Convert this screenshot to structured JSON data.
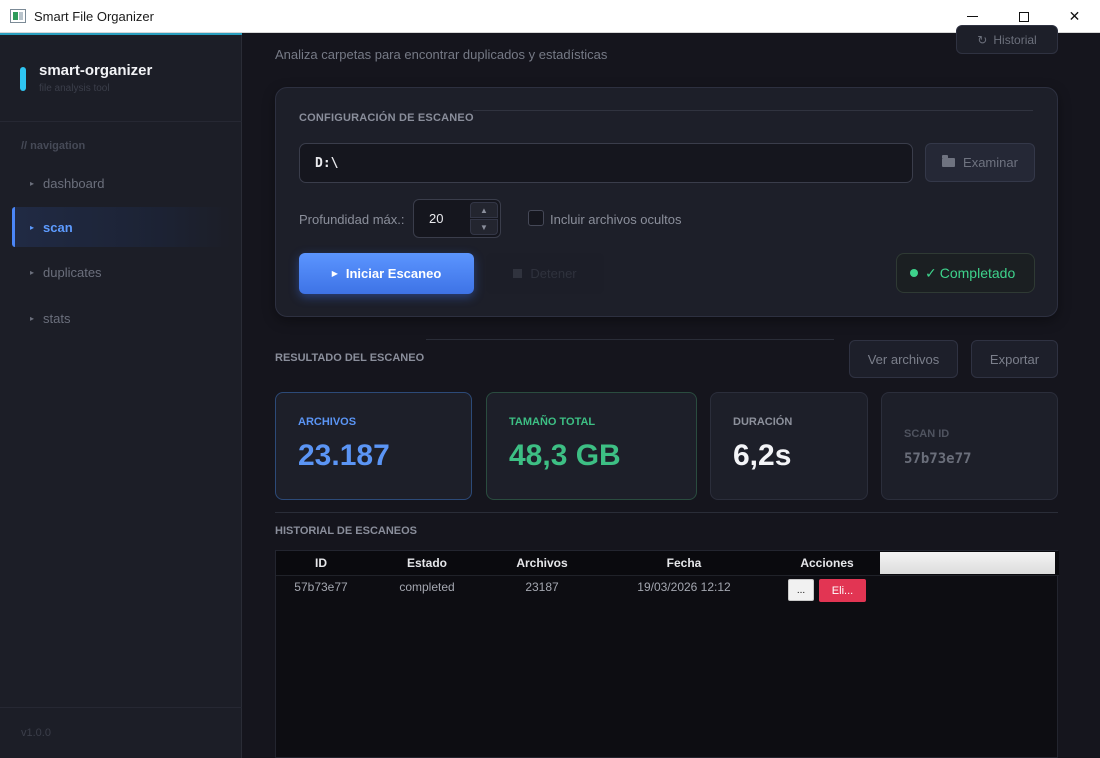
{
  "window": {
    "title": "Smart File Organizer"
  },
  "sidebar": {
    "brand_title": "smart-organizer",
    "brand_subtitle": "file analysis tool",
    "nav_header": "// navigation",
    "items": [
      {
        "label": "dashboard",
        "active": false
      },
      {
        "label": "scan",
        "active": true
      },
      {
        "label": "duplicates",
        "active": false
      },
      {
        "label": "stats",
        "active": false
      }
    ],
    "version": "v1.0.0"
  },
  "header": {
    "subtitle": "Analiza carpetas para encontrar duplicados y estadísticas",
    "history_button": "Historial"
  },
  "config": {
    "title": "CONFIGURACIÓN DE ESCANEO",
    "path_value": "D:\\",
    "browse_button": "Examinar",
    "depth_label": "Profundidad máx.:",
    "depth_value": "20",
    "include_hidden_label": "Incluir archivos ocultos",
    "include_hidden_checked": false,
    "start_button": "Iniciar Escaneo",
    "stop_button": "Detener",
    "status": "Completado",
    "status_color": "#3ed38c"
  },
  "results": {
    "title": "RESULTADO DEL ESCANEO",
    "view_files_button": "Ver archivos",
    "export_button": "Exportar",
    "stats": {
      "files_label": "ARCHIVOS",
      "files_value": "23.187",
      "size_label": "TAMAÑO TOTAL",
      "size_value": "48,3 GB",
      "duration_label": "DURACIÓN",
      "duration_value": "6,2s",
      "scan_id_label": "SCAN ID",
      "scan_id_value": "57b73e77"
    }
  },
  "history": {
    "title": "HISTORIAL DE ESCANEOS",
    "columns": [
      "ID",
      "Estado",
      "Archivos",
      "Fecha",
      "Acciones"
    ],
    "rows": [
      {
        "id": "57b73e77",
        "status": "completed",
        "files": "23187",
        "date": "19/03/2026 12:12",
        "more_button": "...",
        "delete_button": "Eli..."
      }
    ]
  },
  "colors": {
    "accent": "#4b86f7",
    "success": "#3ed38c",
    "danger": "#e23553",
    "background": "#15151d"
  }
}
